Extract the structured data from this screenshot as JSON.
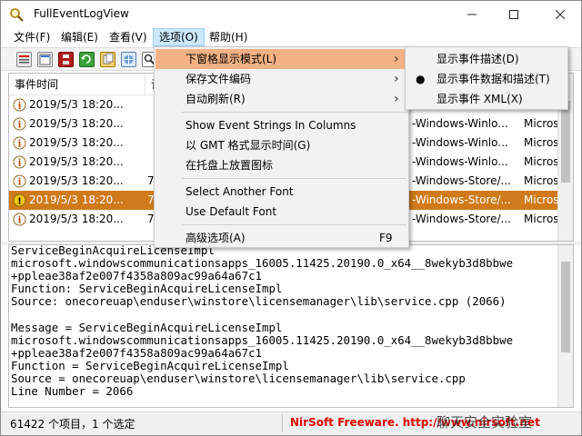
{
  "window": {
    "title": "FullEventLogView",
    "icons": {
      "app": "magnifier-icon",
      "minimize": "minimize-icon",
      "maximize": "maximize-icon",
      "close": "close-icon"
    }
  },
  "menubar": {
    "items": [
      "文件(F)",
      "编辑(E)",
      "查看(V)",
      "选项(O)",
      "帮助(H)"
    ],
    "active_index": 3
  },
  "toolbar": {
    "icons": [
      "log-list-icon",
      "properties-icon",
      "save-icon",
      "refresh-icon",
      "copy-icon",
      "html-report-icon",
      "find-icon"
    ]
  },
  "list": {
    "columns": [
      "事件时间",
      "记"
    ],
    "rows": [
      {
        "time": "2019/5/3 18:20...",
        "id": "",
        "provider": "",
        "channel": "",
        "icon": "info-icon",
        "selected": false
      },
      {
        "time": "2019/5/3 18:20...",
        "id": "",
        "provider": "-Windows-Winlo...",
        "channel": "Micros",
        "icon": "info-icon",
        "selected": false
      },
      {
        "time": "2019/5/3 18:20...",
        "id": "",
        "provider": "-Windows-Winlo...",
        "channel": "Micros",
        "icon": "info-icon",
        "selected": false
      },
      {
        "time": "2019/5/3 18:20...",
        "id": "",
        "provider": "-Windows-Winlo...",
        "channel": "Micros",
        "icon": "info-icon",
        "selected": false
      },
      {
        "time": "2019/5/3 18:20...",
        "id": "7",
        "provider": "-Windows-Store/...",
        "channel": "Micros",
        "icon": "info-icon",
        "selected": false
      },
      {
        "time": "2019/5/3 18:20...",
        "id": "7",
        "provider": "-Windows-Store/...",
        "channel": "Micros",
        "icon": "warning-icon",
        "selected": true
      },
      {
        "time": "2019/5/3 18:20...",
        "id": "7",
        "provider": "-Windows-Store/...",
        "channel": "Micros",
        "icon": "info-icon",
        "selected": false
      }
    ]
  },
  "detail": {
    "lines": [
      "ServiceBeginAcquireLicenseImpl",
      "microsoft.windowscommunicationsapps_16005.11425.20190.0_x64__8wekyb3d8bbwe",
      "+ppleae38af2e007f4358a809ac99a64a67c1",
      "Function: ServiceBeginAcquireLicenseImpl",
      "Source: onecoreuap\\enduser\\winstore\\licensemanager\\lib\\service.cpp (2066)",
      "",
      "Message = ServiceBeginAcquireLicenseImpl",
      "microsoft.windowscommunicationsapps_16005.11425.20190.0_x64__8wekyb3d8bbwe",
      "+ppleae38af2e007f4358a809ac99a64a67c1",
      "Function = ServiceBeginAcquireLicenseImpl",
      "Source = onecoreuap\\enduser\\winstore\\licensemanager\\lib\\service.cpp",
      "Line Number = 2066"
    ]
  },
  "statusbar": {
    "count_text": "61422 个项目，1 个选定",
    "link_text": "NirSoft Freeware.  http://www.nirsoft.net",
    "watermark": "聊天安全实验室"
  },
  "options_menu": {
    "items": [
      {
        "label": "下窗格显示模式(L)",
        "submenu": true,
        "hover": true
      },
      {
        "label": "保存文件编码",
        "submenu": true
      },
      {
        "label": "自动刷新(R)",
        "submenu": true
      },
      {
        "separator": true
      },
      {
        "label": "Show Event Strings In Columns"
      },
      {
        "label": "以 GMT 格式显示时间(G)"
      },
      {
        "label": "在托盘上放置图标"
      },
      {
        "separator": true
      },
      {
        "label": "Select Another Font"
      },
      {
        "label": "Use Default Font"
      },
      {
        "separator": true
      },
      {
        "label": "高级选项(A)",
        "shortcut": "F9"
      }
    ]
  },
  "submenu": {
    "items": [
      {
        "label": "显示事件描述(D)",
        "checked": false
      },
      {
        "label": "显示事件数据和描述(T)",
        "checked": true
      },
      {
        "label": "显示事件 XML(X)",
        "checked": false
      }
    ],
    "bullet": "●"
  },
  "colors": {
    "selected_row": "#d07a1b",
    "menu_hover": "#f4b183",
    "status_link": "#e00000"
  }
}
